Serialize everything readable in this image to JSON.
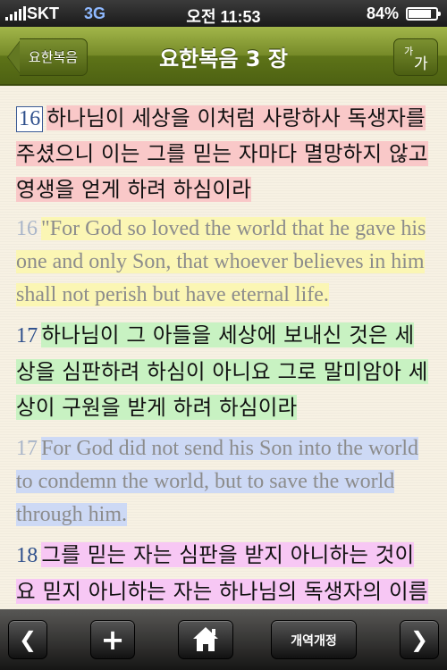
{
  "status_bar": {
    "carrier": "SKT",
    "network": "3G",
    "time": "오전 11:53",
    "battery": "84%",
    "battery_level": 0.84
  },
  "nav": {
    "back_label": "요한복음",
    "title": "요한복음 3 장",
    "font_small": "가",
    "font_large": "가"
  },
  "verses": [
    {
      "number": "16",
      "text": "하나님이 세상을 이처럼 사랑하사 독생자를 주셨으니 이는 그를 믿는 자마다 멸망하지 않고 영생을 얻게 하려 하심이라",
      "lang": "ko",
      "highlight": "#f9c8c8"
    },
    {
      "number": "16",
      "text": "\"For God so loved the world that he gave his one and only Son, that whoever believes in him shall not perish but have eternal life.",
      "lang": "en",
      "highlight": "#fbf6b4"
    },
    {
      "number": "17",
      "text": "하나님이 그 아들을 세상에 보내신 것은 세상을 심판하려 하심이 아니요 그로 말미암아 세상이 구원을 받게 하려 하심이라",
      "lang": "ko",
      "highlight": "#c8f2c2"
    },
    {
      "number": "17",
      "text": "For God did not send his Son into the world to condemn the world, but to save the world through him.",
      "lang": "en",
      "highlight": "#cdd9f5"
    },
    {
      "number": "18",
      "text": "그를 믿는 자는 심판을 받지 아니하는 것이요 믿지 아니하는 자는 하나님의 독생자의 이름을 믿지 아니하므로 벌써 심판을 받은 것이니라",
      "lang": "ko",
      "highlight": "#f7c7f4"
    }
  ],
  "toolbar": {
    "prev_icon": "chevron-left-icon",
    "prev_glyph": "❮",
    "add_glyph": "+",
    "home_icon": "home-icon",
    "version_label": "개역개정",
    "next_glyph": "❯"
  },
  "colors": {
    "nav_green": "#6f8526",
    "verse_number": "#2e4f8c"
  }
}
